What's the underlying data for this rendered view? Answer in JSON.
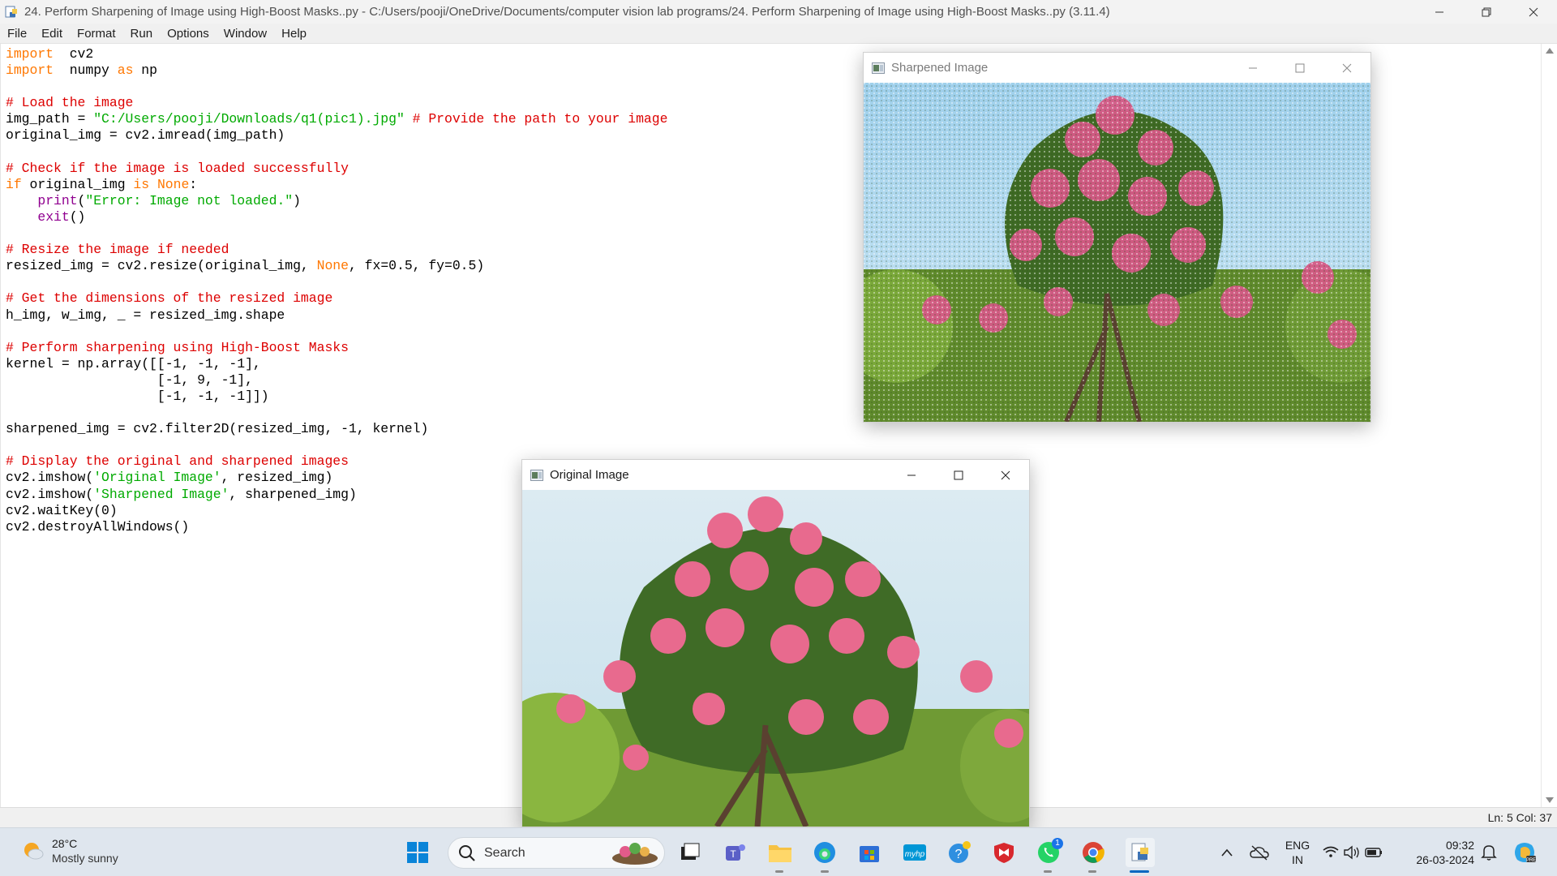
{
  "window": {
    "title": "24. Perform Sharpening of Image using High-Boost Masks..py - C:/Users/pooji/OneDrive/Documents/computer vision lab programs/24. Perform Sharpening of Image using High-Boost Masks..py (3.11.4)"
  },
  "menu": [
    "File",
    "Edit",
    "Format",
    "Run",
    "Options",
    "Window",
    "Help"
  ],
  "code": [
    [
      [
        "kw",
        "import"
      ],
      [
        "",
        "  cv2"
      ]
    ],
    [
      [
        "kw",
        "import"
      ],
      [
        "",
        "  numpy "
      ],
      [
        "kw",
        "as"
      ],
      [
        "",
        " np"
      ]
    ],
    [],
    [
      [
        "cm",
        "# Load the image"
      ]
    ],
    [
      [
        "",
        "img_path = "
      ],
      [
        "st",
        "\"C:/Users/pooji/Downloads/q1(pic1).jpg\""
      ],
      [
        "",
        " "
      ],
      [
        "cm",
        "# Provide the path to your image"
      ]
    ],
    [
      [
        "",
        "original_img = cv2.imread(img_path)"
      ]
    ],
    [],
    [
      [
        "cm",
        "# Check if the image is loaded successfully"
      ]
    ],
    [
      [
        "kw",
        "if"
      ],
      [
        "",
        " original_img "
      ],
      [
        "kw",
        "is"
      ],
      [
        "",
        " "
      ],
      [
        "kw",
        "None"
      ],
      [
        "",
        ":"
      ]
    ],
    [
      [
        "",
        "    "
      ],
      [
        "bi",
        "print"
      ],
      [
        "",
        "("
      ],
      [
        "st",
        "\"Error: Image not loaded.\""
      ],
      [
        "",
        ")"
      ]
    ],
    [
      [
        "",
        "    "
      ],
      [
        "bi",
        "exit"
      ],
      [
        "",
        "()"
      ]
    ],
    [],
    [
      [
        "cm",
        "# Resize the image if needed"
      ]
    ],
    [
      [
        "",
        "resized_img = cv2.resize(original_img, "
      ],
      [
        "kw",
        "None"
      ],
      [
        "",
        ", fx=0.5, fy=0.5)"
      ]
    ],
    [],
    [
      [
        "cm",
        "# Get the dimensions of the resized image"
      ]
    ],
    [
      [
        "",
        "h_img, w_img, _ = resized_img.shape"
      ]
    ],
    [],
    [
      [
        "cm",
        "# Perform sharpening using High-Boost Masks"
      ]
    ],
    [
      [
        "",
        "kernel = np.array([[-1, -1, -1],"
      ]
    ],
    [
      [
        "",
        "                   [-1, 9, -1],"
      ]
    ],
    [
      [
        "",
        "                   [-1, -1, -1]])"
      ]
    ],
    [],
    [
      [
        "",
        "sharpened_img = cv2.filter2D(resized_img, -1, kernel)"
      ]
    ],
    [],
    [
      [
        "cm",
        "# Display the original and sharpened images"
      ]
    ],
    [
      [
        "",
        "cv2.imshow("
      ],
      [
        "st",
        "'Original Image'"
      ],
      [
        "",
        ", resized_img)"
      ]
    ],
    [
      [
        "",
        "cv2.imshow("
      ],
      [
        "st",
        "'Sharpened Image'"
      ],
      [
        "",
        ", sharpened_img)"
      ]
    ],
    [
      [
        "",
        "cv2.waitKey(0)"
      ]
    ],
    [
      [
        "",
        "cv2.destroyAllWindows()"
      ]
    ]
  ],
  "status": {
    "position": "Ln: 5   Col: 37"
  },
  "sharpened_window": {
    "title": "Sharpened Image"
  },
  "original_window": {
    "title": "Original Image"
  },
  "taskbar": {
    "weather": {
      "temp": "28°C",
      "condition": "Mostly sunny"
    },
    "search_label": "Search",
    "whatsapp_badge": "1",
    "language": "ENG",
    "region": "IN",
    "time": "09:32",
    "date": "26-03-2024"
  },
  "colors": {
    "keyword": "#ff7700",
    "comment": "#dd0000",
    "string": "#00aa00",
    "builtin": "#900090"
  }
}
